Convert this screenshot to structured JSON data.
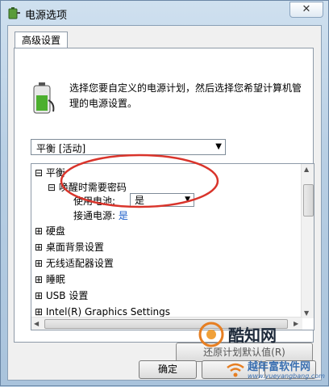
{
  "window": {
    "title": "电源选项",
    "close_label": "✕"
  },
  "tab": {
    "label": "高级设置"
  },
  "description": "选择您要自定义的电源计划，然后选择您希望计算机管理的电源设置。",
  "plan_select": {
    "value": "平衡 [活动]"
  },
  "tree": {
    "items": [
      {
        "toggle": "⊟",
        "label": "平衡"
      },
      {
        "toggle": "⊟",
        "label": "唤醒时需要密码"
      },
      {
        "label": "使用电池:"
      },
      {
        "label": "接通电源:",
        "value": "是"
      },
      {
        "toggle": "⊞",
        "label": "硬盘"
      },
      {
        "toggle": "⊞",
        "label": "桌面背景设置"
      },
      {
        "toggle": "⊞",
        "label": "无线适配器设置"
      },
      {
        "toggle": "⊞",
        "label": "睡眠"
      },
      {
        "toggle": "⊞",
        "label": "USB 设置"
      },
      {
        "toggle": "⊞",
        "label": "Intel(R) Graphics Settings"
      }
    ],
    "battery_select_value": "是"
  },
  "buttons": {
    "restore": "还原计划默认值(R)",
    "ok": "确定"
  },
  "watermarks": {
    "brand1": "酷知网",
    "brand2": "越年富软件网",
    "url": "www.yueyangbang.com"
  },
  "colors": {
    "annotation": "#d9342b",
    "link": "#1a5cc8"
  },
  "icons": [
    "power-options-icon",
    "battery-plug-icon",
    "close-icon",
    "chevron-down-icon"
  ]
}
